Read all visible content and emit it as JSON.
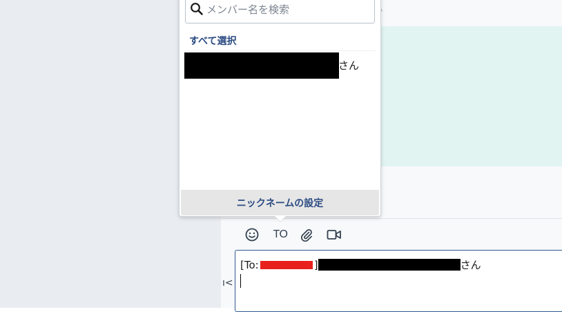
{
  "mention_popup": {
    "search": {
      "placeholder": "メンバー名を検索",
      "value": ""
    },
    "select_all_label": "すべて選択",
    "members": [
      {
        "name_suffix": "さん"
      }
    ],
    "nickname_button_label": "ニックネームの設定"
  },
  "toolbar": {
    "emoji_icon": "smile-icon",
    "to_label": "TO",
    "attach_icon": "paperclip-icon",
    "video_icon": "video-camera-icon"
  },
  "editor": {
    "prefix": "[To:",
    "bracket_close": "]",
    "suffix": "さん"
  },
  "side_glyph": "ﾍ",
  "collapse_glyph": "ı<",
  "colors": {
    "accent_navy": "#2b4b82",
    "editor_border": "#2f5a8f",
    "chat_highlight": "#e1f4f2",
    "left_panel": "#e9edf1",
    "redaction_red": "#e8201e"
  }
}
